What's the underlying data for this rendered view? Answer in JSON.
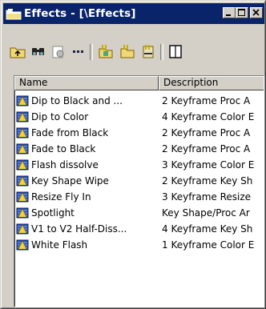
{
  "window": {
    "title": "Effects - [\\Effects]",
    "icon": "folder-icon"
  },
  "toolbar": {
    "buttons": [
      {
        "icon": "up-folder-icon"
      },
      {
        "icon": "find-icon"
      },
      {
        "icon": "properties-icon"
      },
      {
        "icon": "list-view-icon"
      },
      {
        "icon": "new-bin-icon"
      },
      {
        "icon": "new-folder-icon"
      },
      {
        "icon": "delete-bin-icon"
      },
      {
        "icon": "columns-icon"
      }
    ]
  },
  "list": {
    "columns": [
      "Name",
      "Description"
    ],
    "rows": [
      {
        "name": "Dip to Black and ...",
        "description": "2 Keyframe Proc A"
      },
      {
        "name": "Dip to Color",
        "description": "4 Keyframe Color E"
      },
      {
        "name": "Fade from Black",
        "description": "2 Keyframe Proc A"
      },
      {
        "name": "Fade to Black",
        "description": "2 Keyframe Proc A"
      },
      {
        "name": "Flash dissolve",
        "description": "3 Keyframe Color E"
      },
      {
        "name": "Key Shape Wipe",
        "description": "2 Keyframe Key Sh"
      },
      {
        "name": "Resize Fly In",
        "description": "3 Keyframe Resize"
      },
      {
        "name": "Spotlight",
        "description": "Key Shape/Proc Ar"
      },
      {
        "name": "V1 to V2 Half-Diss...",
        "description": "4 Keyframe Key Sh"
      },
      {
        "name": "White Flash",
        "description": "1 Keyframe Color E"
      }
    ],
    "row_icon": "effect-icon"
  }
}
